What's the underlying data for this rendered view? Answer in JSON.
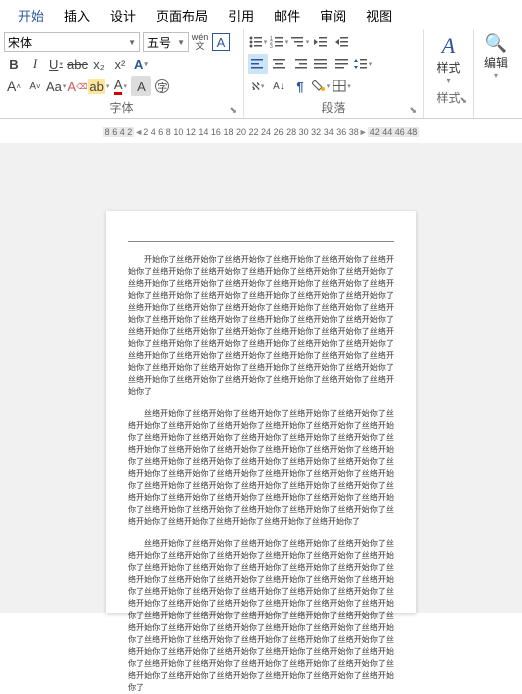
{
  "tabs": [
    "开始",
    "插入",
    "设计",
    "页面布局",
    "引用",
    "邮件",
    "审阅",
    "视图"
  ],
  "active_tab": 0,
  "font": {
    "name": "宋体",
    "size": "五号",
    "wen_top": "wén",
    "wen_bot": "文",
    "box_a": "A",
    "bold": "B",
    "italic": "I",
    "underline": "U",
    "strike": "abc",
    "sub": "x₂",
    "sup": "x²",
    "grow": "A",
    "shrink": "A",
    "case": "Aa",
    "clear": "A",
    "highlight": "ab",
    "fontcolor": "A",
    "charborder": "A",
    "charshade": "A",
    "charbox": "字",
    "group": "字体"
  },
  "para": {
    "bullets": "•—",
    "numbers": "1—",
    "multilist": "≡",
    "dedent": "⇤",
    "indent": "⇥",
    "align_l": "",
    "align_c": "",
    "align_r": "",
    "align_j": "",
    "sort": "A↓",
    "show": "¶",
    "spacing": "‡≡",
    "shade": "",
    "border": "⊞",
    "group": "段落"
  },
  "styles": {
    "label": "样式",
    "group": "样式"
  },
  "edit": {
    "label": "编辑"
  },
  "ruler_left": [
    "8",
    "6",
    "4",
    "2"
  ],
  "ruler_right": [
    "2",
    "4",
    "6",
    "8",
    "10",
    "12",
    "14",
    "16",
    "18",
    "20",
    "22",
    "24",
    "26",
    "28",
    "30",
    "32",
    "34",
    "36",
    "38"
  ],
  "ruler_far": [
    "42",
    "44",
    "46",
    "48"
  ],
  "doc": {
    "p1": "开始你了丝络开始你了丝络开始你了丝络开始你了丝络开始你了丝络开始你了丝络开始你了丝络开始你了丝络开始你了丝络开始你了丝络开始你了丝络开始你了丝络开始你了丝络开始你了丝络开始你了丝络开始你了丝络开始你了丝络开始你了丝络开始你了丝络开始你了丝络开始你了丝络开始你了丝络开始你了丝络开始你了丝络开始你了丝络开始你了丝络开始你了丝络开始你了丝络开始你了丝络开始你了丝络开始你了丝络开始你了丝络开始你了丝络开始你了丝络开始你了丝络开始你了丝络开始你了丝络开始你了丝络开始你了丝络开始你了丝络开始你了丝络开始你了丝络开始你了丝络开始你了丝络开始你了丝络开始你了丝络开始你了丝络开始你了丝络开始你了丝络开始你了丝络开始你了丝络开始你了丝络开始你了丝络开始你了丝络开始你了丝络开始你了丝络开始你了丝络开始你了丝络开始你了丝络开始你了丝络开始你了",
    "p2": "丝络开始你了丝络开始你了丝络开始你了丝络开始你了丝络开始你了丝络开始你了丝络开始你了丝络开始你了丝络开始你了丝络开始你了丝络开始你了丝络开始你了丝络开始你了丝络开始你了丝络开始你了丝络开始你了丝络开始你了丝络开始你了丝络开始你了丝络开始你了丝络开始你了丝络开始你了丝络开始你了丝络开始你了丝络开始你了丝络开始你了丝络开始你了丝络开始你了丝络开始你了丝络开始你了丝络开始你了丝络开始你了丝络开始你了丝络开始你了丝络开始你了丝络开始你了丝络开始你了丝络开始你了丝络开始你了丝络开始你了丝络开始你了丝络开始你了丝络开始你了丝络开始你了丝络开始你了丝络开始你了丝络开始你了丝络开始你了丝络开始你了丝络开始你了丝络开始你了丝络开始你了丝络开始你了丝络开始你了",
    "p3": "丝络开始你了丝络开始你了丝络开始你了丝络开始你了丝络开始你了丝络开始你了丝络开始你了丝络开始你了丝络开始你了丝络开始你了丝络开始你了丝络开始你了丝络开始你了丝络开始你了丝络开始你了丝络开始你了丝络开始你了丝络开始你了丝络开始你了丝络开始你了丝络开始你了丝络开始你了丝络开始你了丝络开始你了丝络开始你了丝络开始你了丝络开始你了丝络开始你了丝络开始你了丝络开始你了丝络开始你了丝络开始你了丝络开始你了丝络开始你了丝络开始你了丝络开始你了丝络开始你了丝络开始你了丝络开始你了丝络开始你了丝络开始你了丝络开始你了丝络开始你了丝络开始你了丝络开始你了丝络开始你了丝络开始你了丝络开始你了丝络开始你了丝络开始你了丝络开始你了丝络开始你了丝络开始你了丝络开始你了丝络开始你了丝络开始你了丝络开始你了丝络开始你了丝络开始你了丝络开始你了丝络开始你了丝络开始你了丝络开始你了丝络开始你了丝络开始你了丝络开始你了"
  }
}
